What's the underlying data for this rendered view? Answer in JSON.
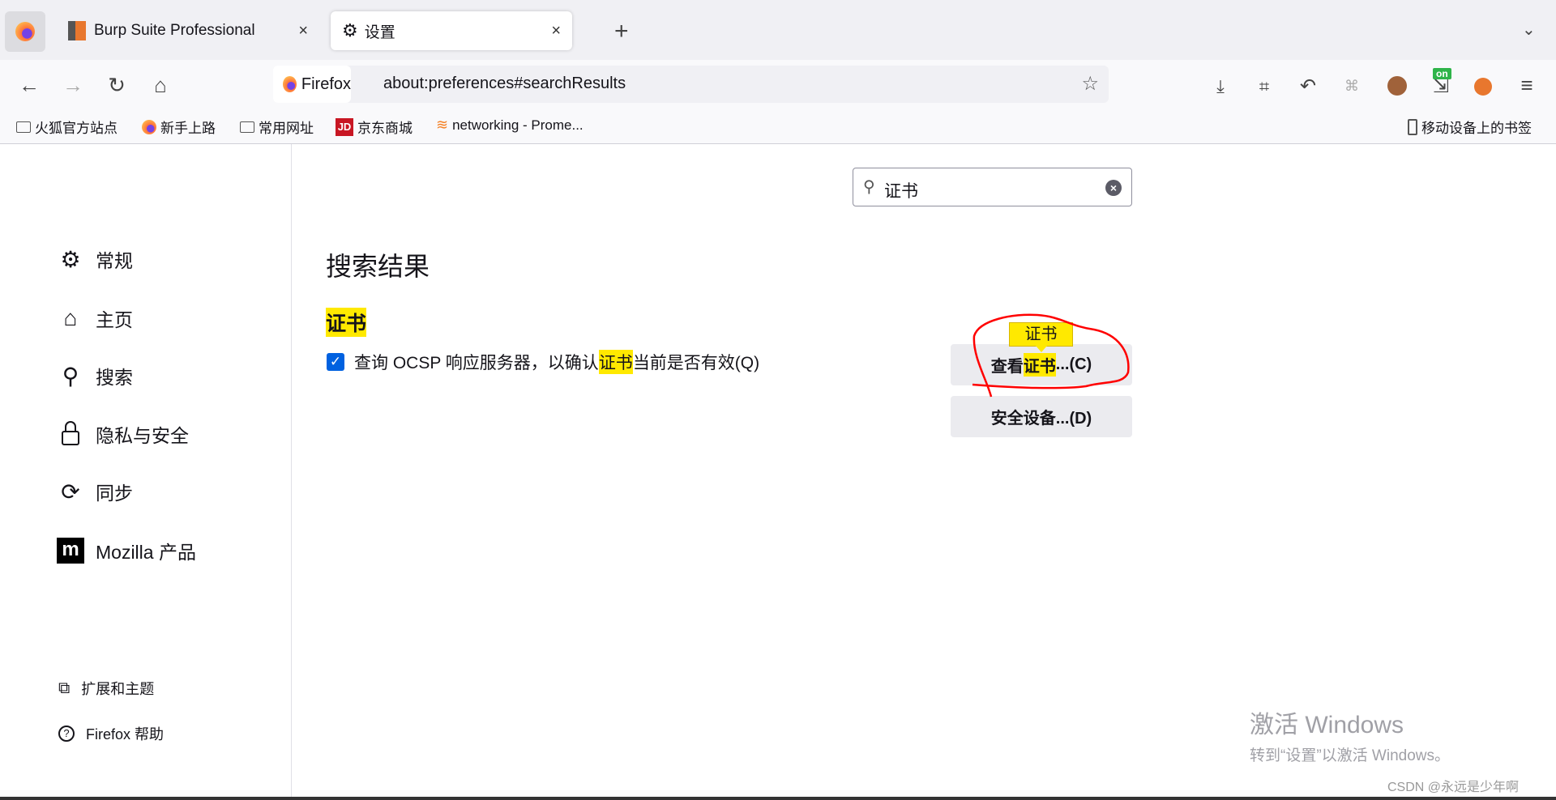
{
  "tabs": [
    {
      "label": "Burp Suite Professional",
      "close": "×"
    },
    {
      "label": "设置",
      "close": "×",
      "active": true
    }
  ],
  "new_tab": "+",
  "address": {
    "identity": "Firefox",
    "url": "about:preferences#searchResults"
  },
  "bookmarks": [
    "火狐官方站点",
    "新手上路",
    "常用网址",
    "京东商城",
    "networking - Prome..."
  ],
  "mobile_bookmarks": "移动设备上的书签",
  "toolbar_badge": "on",
  "sidebar": {
    "items": [
      "常规",
      "主页",
      "搜索",
      "隐私与安全",
      "同步",
      "Mozilla 产品"
    ],
    "footer": [
      "扩展和主题",
      "Firefox 帮助"
    ]
  },
  "search": {
    "value": "证书"
  },
  "main": {
    "title": "搜索结果",
    "section": "证书",
    "checkbox": {
      "before": "查询 OCSP 响应服务器，以确认",
      "highlight": "证书",
      "after": "当前是否有效(Q)",
      "checked": true
    },
    "buttons": [
      {
        "before": "查看",
        "highlight": "证书",
        "after": "...(C)"
      },
      {
        "label": "安全设备...(D)"
      }
    ],
    "tooltip": "证书"
  },
  "watermark": {
    "line1": "激活 Windows",
    "line2": "转到“设置”以激活 Windows。"
  },
  "credit": "CSDN @永远是少年啊",
  "colors": {
    "highlight": "#ffe900",
    "accent": "#0061e0",
    "annotation": "#ff0000"
  }
}
